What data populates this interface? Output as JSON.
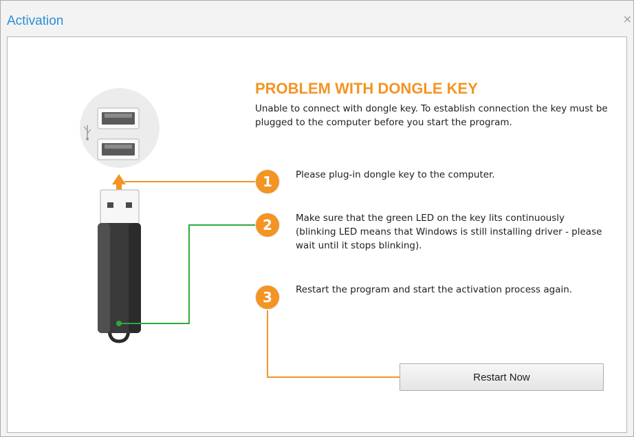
{
  "window": {
    "title": "Activation",
    "close_glyph": "×"
  },
  "problem": {
    "heading": "PROBLEM WITH DONGLE KEY",
    "description": "Unable to connect with dongle key. To establish connection the key must be plugged to the computer before you start the program."
  },
  "steps": [
    {
      "number": "1",
      "text": "Please plug-in dongle key to the computer."
    },
    {
      "number": "2",
      "text": "Make sure that the green LED on the key lits continuously (blinking LED means that Windows is still installing driver - please wait until it stops blinking)."
    },
    {
      "number": "3",
      "text": "Restart the program and start the activation process again."
    }
  ],
  "actions": {
    "restart_label": "Restart Now"
  },
  "icons": {
    "usb_ports": "usb-ports-icon",
    "usb_symbol": "usb-symbol-icon",
    "dongle": "usb-dongle-icon",
    "led": "green-led-icon"
  },
  "colors": {
    "accent": "#f39423",
    "title_blue": "#2b8fd6",
    "led_green": "#2fa83a"
  }
}
